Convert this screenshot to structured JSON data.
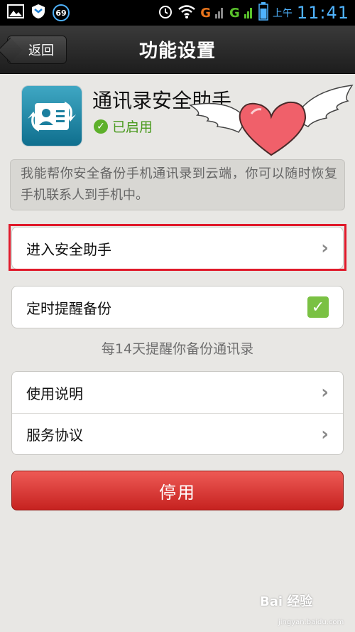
{
  "status_bar": {
    "notification_badge": "69",
    "signal_g1": "G",
    "signal_g2": "G",
    "ampm": "上午",
    "time": "11:41"
  },
  "titlebar": {
    "back_label": "返回",
    "title": "功能设置"
  },
  "app": {
    "name": "通讯录安全助手",
    "status": "已启用",
    "description": "我能帮你安全备份手机通讯录到云端，你可以随时恢复手机联系人到手机中。"
  },
  "rows": {
    "enter_helper": "进入安全助手",
    "scheduled_backup": "定时提醒备份",
    "reminder_text": "每14天提醒你备份通讯录",
    "usage_guide": "使用说明",
    "service_agreement": "服务协议"
  },
  "disable_button": "停用",
  "watermark": {
    "brand": "Bai 经验",
    "url": "jingyan.baidu.com"
  },
  "icons": [
    "image-icon",
    "shield-icon",
    "alarm-icon",
    "wifi-icon",
    "battery-icon",
    "chevron-right-icon",
    "check-icon"
  ],
  "colors": {
    "status_time": "#4fb3ff",
    "enabled_green": "#4a9a1e",
    "checkbox_green": "#7ac143",
    "disable_red": "#d63a35",
    "highlight_red": "#e0192a"
  },
  "scheduled_backup_checked": true
}
